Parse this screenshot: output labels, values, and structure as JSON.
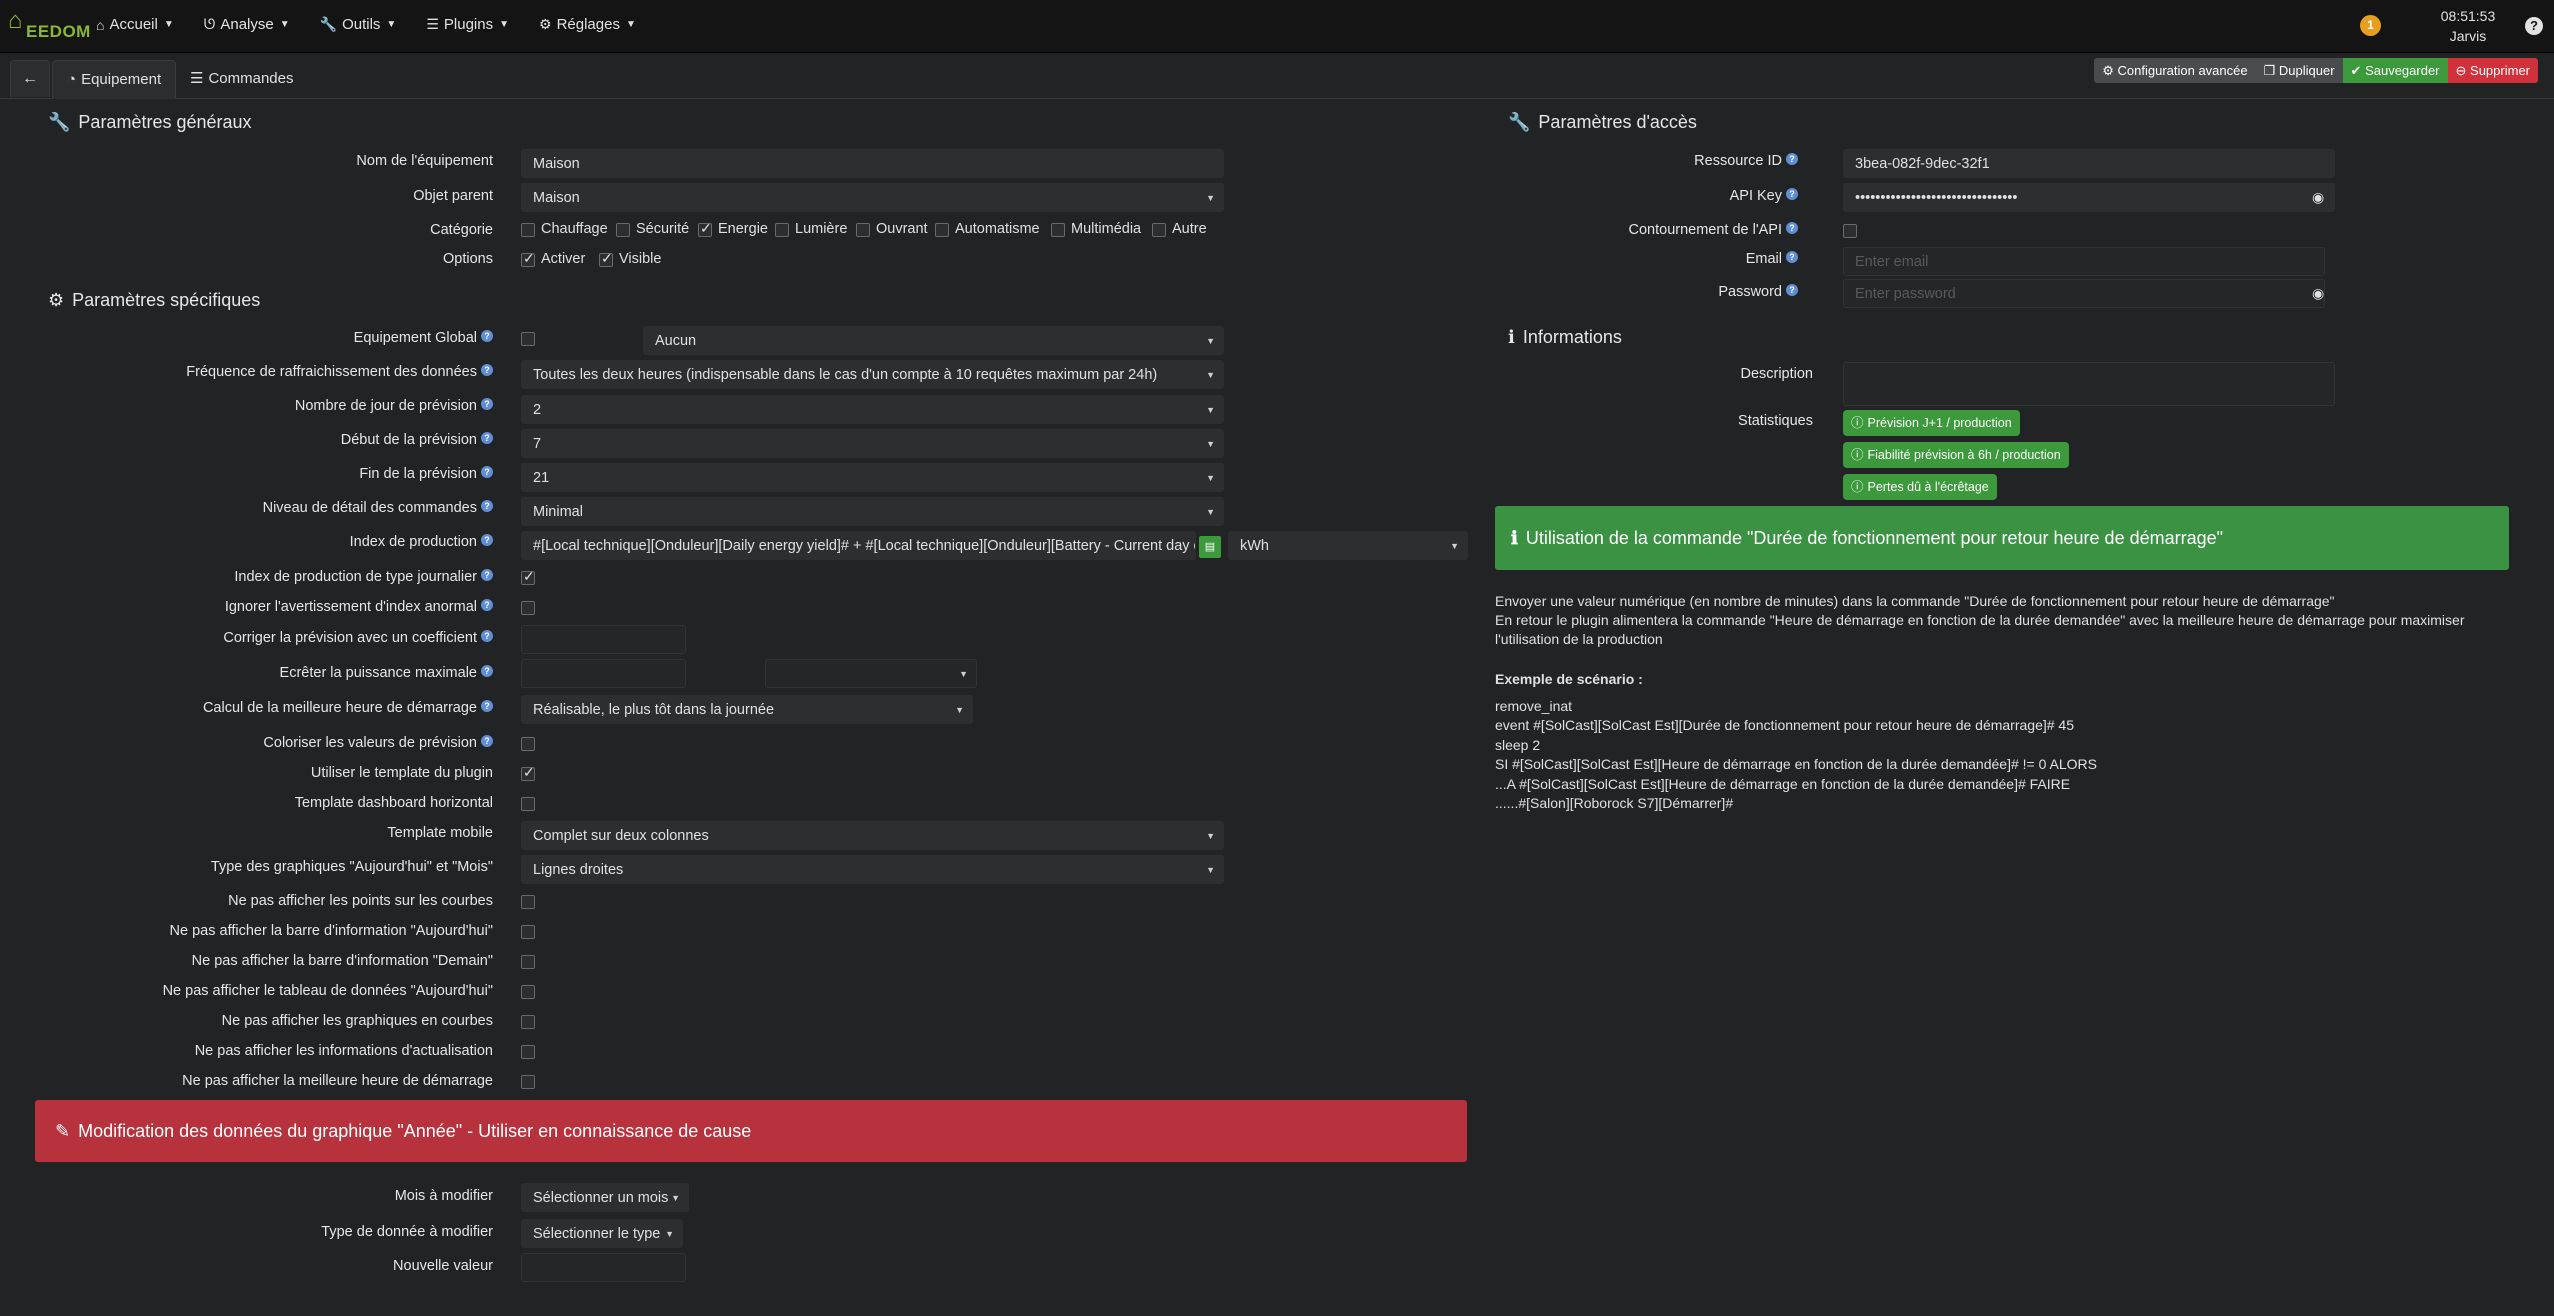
{
  "navbar": {
    "logo_text": "EEDOM",
    "menu": [
      {
        "label": "Accueil",
        "icon": "home-icon"
      },
      {
        "label": "Analyse",
        "icon": "stethoscope-icon"
      },
      {
        "label": "Outils",
        "icon": "wrench-icon"
      },
      {
        "label": "Plugins",
        "icon": "list-icon"
      },
      {
        "label": "Réglages",
        "icon": "cogs-icon"
      }
    ],
    "notifications": "1",
    "time": "08:51:53",
    "user": "Jarvis",
    "help": "?"
  },
  "tabs": {
    "back": "←",
    "equipement": "Equipement",
    "commandes": "Commandes"
  },
  "actions": {
    "config": "Configuration avancée",
    "duplicate": "Dupliquer",
    "save": "Sauvegarder",
    "delete": "Supprimer"
  },
  "general": {
    "title": "Paramètres généraux",
    "name_label": "Nom de l'équipement",
    "name_value": "Maison",
    "parent_label": "Objet parent",
    "parent_value": "Maison",
    "category_label": "Catégorie",
    "categories": [
      {
        "label": "Chauffage",
        "checked": false
      },
      {
        "label": "Sécurité",
        "checked": false
      },
      {
        "label": "Energie",
        "checked": true
      },
      {
        "label": "Lumière",
        "checked": false
      },
      {
        "label": "Ouvrant",
        "checked": false
      },
      {
        "label": "Automatisme",
        "checked": false
      },
      {
        "label": "Multimédia",
        "checked": false
      },
      {
        "label": "Autre",
        "checked": false
      }
    ],
    "options_label": "Options",
    "options": [
      {
        "label": "Activer",
        "checked": true
      },
      {
        "label": "Visible",
        "checked": true
      }
    ]
  },
  "specific": {
    "title": "Paramètres spécifiques",
    "global_label": "Equipement Global",
    "global_value": "Aucun",
    "freq_label": "Fréquence de raffraichissement des données",
    "freq_value": "Toutes les deux heures (indispensable dans le cas d'un compte à 10 requêtes maximum par 24h)",
    "days_label": "Nombre de jour de prévision",
    "days_value": "2",
    "start_label": "Début de la prévision",
    "start_value": "7",
    "end_label": "Fin de la prévision",
    "end_value": "21",
    "detail_label": "Niveau de détail des commandes",
    "detail_value": "Minimal",
    "index_label": "Index de production",
    "index_value": "#[Local technique][Onduleur][Daily energy yield]# + #[Local technique][Onduleur][Battery - Current day ch",
    "index_unit": "kWh",
    "daily_label": "Index de production de type journalier",
    "ignore_label": "Ignorer l'avertissement d'index anormal",
    "coef_label": "Corriger la prévision avec un coefficient",
    "clip_label": "Ecrêter la puissance maximale",
    "best_label": "Calcul de la meilleure heure de démarrage",
    "best_value": "Réalisable, le plus tôt dans la journée",
    "color_label": "Coloriser les valeurs de prévision",
    "template_label": "Utiliser le template du plugin",
    "horiz_label": "Template dashboard horizontal",
    "mobile_label": "Template mobile",
    "mobile_value": "Complet sur deux colonnes",
    "graph_label": "Type des graphiques \"Aujourd'hui\" et \"Mois\"",
    "graph_value": "Lignes droites",
    "hide": [
      "Ne pas afficher les points sur les courbes",
      "Ne pas afficher la barre d'information \"Aujourd'hui\"",
      "Ne pas afficher la barre d'information \"Demain\"",
      "Ne pas afficher le tableau de données \"Aujourd'hui\"",
      "Ne pas afficher les graphiques en courbes",
      "Ne pas afficher les informations d'actualisation",
      "Ne pas afficher la meilleure heure de démarrage"
    ]
  },
  "year": {
    "banner": "Modification des données du graphique \"Année\" - Utiliser en connaissance de cause",
    "month_label": "Mois à modifier",
    "month_value": "Sélectionner un mois",
    "type_label": "Type de donnée à modifier",
    "type_value": "Sélectionner le type",
    "new_label": "Nouvelle valeur"
  },
  "access": {
    "title": "Paramètres d'accès",
    "resource_label": "Ressource ID",
    "resource_value": "3bea-082f-9dec-32f1",
    "api_label": "API Key",
    "api_value": "••••••••••••••••••••••••••••••••",
    "bypass_label": "Contournement de l'API",
    "email_label": "Email",
    "email_placeholder": "Enter email",
    "password_label": "Password",
    "password_placeholder": "Enter password"
  },
  "informations": {
    "title": "Informations",
    "description_label": "Description",
    "stats_label": "Statistiques",
    "stats": [
      "Prévision J+1 / production",
      "Fiabilité prévision à 6h / production",
      "Pertes dû à l'écrêtage"
    ]
  },
  "usage": {
    "banner": "Utilisation de la commande \"Durée de fonctionnement pour retour heure de démarrage\"",
    "text1": "Envoyer une valeur numérique (en nombre de minutes) dans la commande \"Durée de fonctionnement pour retour heure de démarrage\"",
    "text2": "En retour le plugin alimentera la commande \"Heure de démarrage en fonction de la durée demandée\" avec la meilleure heure de démarrage pour maximiser",
    "text3": "l'utilisation de la production",
    "example_title": "Exemple de scénario :",
    "code": [
      "remove_inat",
      "event #[SolCast][SolCast Est][Durée de fonctionnement pour retour heure de démarrage]# 45",
      "sleep 2",
      "SI #[SolCast][SolCast Est][Heure de démarrage en fonction de la durée demandée]# != 0 ALORS",
      "...A #[SolCast][SolCast Est][Heure de démarrage en fonction de la durée demandée]# FAIRE",
      "......#[Salon][Roborock S7][Démarrer]#"
    ]
  }
}
